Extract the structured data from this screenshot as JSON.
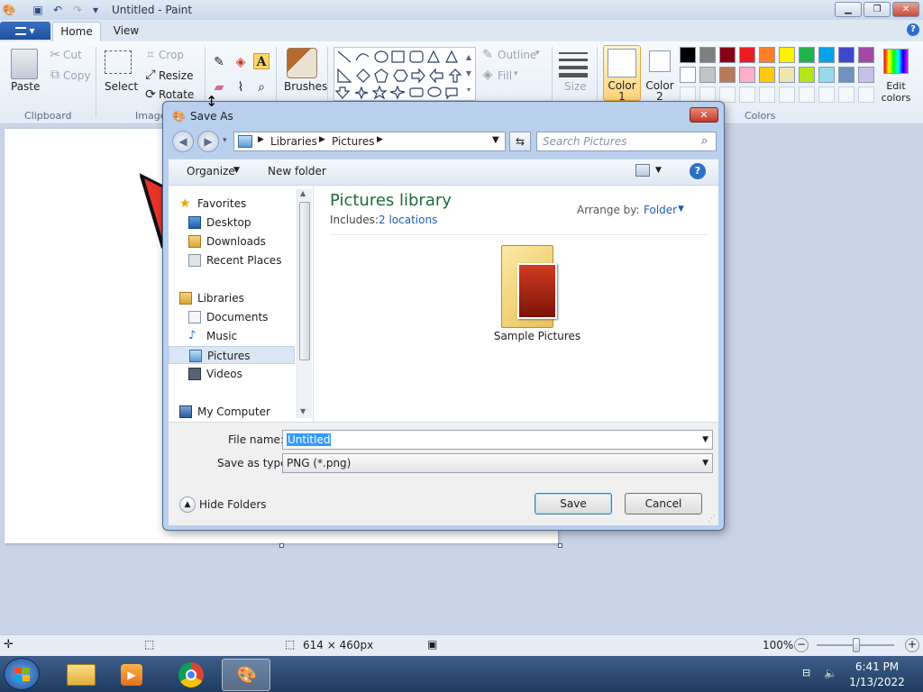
{
  "app": {
    "title": "Untitled - Paint"
  },
  "ribbon": {
    "file_tab": "▾",
    "tabs": [
      "Home",
      "View"
    ],
    "paste_label": "Paste",
    "cut_label": "Cut",
    "copy_label": "Copy",
    "clipboard_group": "Clipboard",
    "select_label": "Select",
    "crop_label": "Crop",
    "resize_label": "Resize",
    "rotate_label": "Rotate",
    "image_group": "Image",
    "brushes_label": "Brushes",
    "outline_label": "Outline",
    "fill_label": "Fill",
    "size_label": "Size",
    "color1_label": "Color 1",
    "color2_label": "Color 2",
    "edit_colors_label": "Edit colors",
    "colors_group": "Colors",
    "palette_row1": [
      "#000000",
      "#7f7f7f",
      "#880015",
      "#ed1c24",
      "#ff7f27",
      "#fff200",
      "#22b14c",
      "#00a2e8",
      "#3f48cc",
      "#a349a4"
    ],
    "palette_row2": [
      "#ffffff",
      "#c3c3c3",
      "#b97a57",
      "#ffaec9",
      "#ffc90e",
      "#efe4b0",
      "#b5e61d",
      "#99d9ea",
      "#7092be",
      "#c8bfe7"
    ]
  },
  "status": {
    "dimensions": "614 × 460px",
    "zoom": "100%"
  },
  "taskbar": {
    "time": "6:41 PM",
    "date": "1/13/2022"
  },
  "dialog": {
    "title": "Save As",
    "breadcrumb": [
      "Libraries",
      "Pictures"
    ],
    "search_placeholder": "Search Pictures",
    "organize_label": "Organize",
    "new_folder_label": "New folder",
    "nav": {
      "favorites": "Favorites",
      "desktop": "Desktop",
      "downloads": "Downloads",
      "recent": "Recent Places",
      "libraries": "Libraries",
      "documents": "Documents",
      "music": "Music",
      "pictures": "Pictures",
      "videos": "Videos",
      "computer": "My Computer"
    },
    "library_title": "Pictures library",
    "includes_label": "Includes:",
    "locations_link": "2 locations",
    "arrange_label": "Arrange by:",
    "arrange_value": "Folder",
    "folder_item": "Sample Pictures",
    "file_name_label": "File name:",
    "file_name_value": "Untitled",
    "save_type_label": "Save as type:",
    "save_type_value": "PNG (*.png)",
    "hide_folders_label": "Hide Folders",
    "save_button": "Save",
    "cancel_button": "Cancel"
  }
}
